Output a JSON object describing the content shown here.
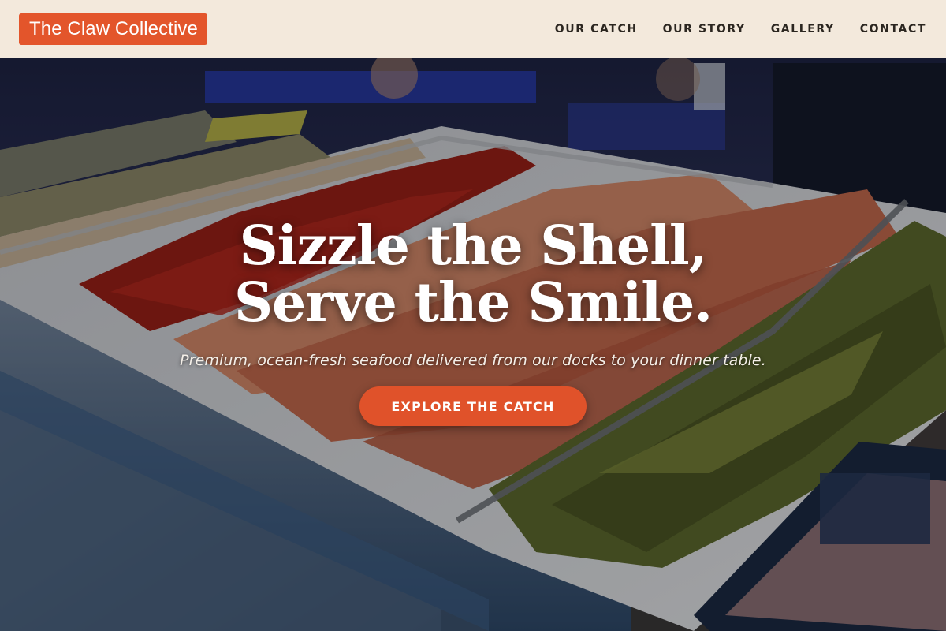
{
  "header": {
    "logo": "The Claw Collective",
    "nav": [
      "OUR CATCH",
      "OUR STORY",
      "GALLERY",
      "CONTACT"
    ]
  },
  "hero": {
    "headline_line1": "Sizzle the Shell,",
    "headline_line2": "Serve the Smile.",
    "tagline": "Premium, ocean-fresh seafood delivered from our docks to your dinner table.",
    "cta_label": "EXPLORE THE CATCH",
    "background_image": "seafood-market-counter-photo"
  },
  "colors": {
    "accent": "#e3552b",
    "header_bg": "#f3e9dc",
    "nav_text": "#2b2620"
  }
}
